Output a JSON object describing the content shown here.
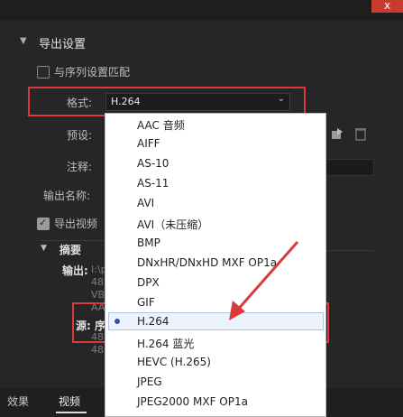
{
  "window": {
    "close_glyph": "x"
  },
  "export_settings": {
    "title": "导出设置",
    "match_sequence_label": "与序列设置匹配",
    "format_label": "格式:",
    "format_value": "H.264",
    "preset_label": "预设:",
    "comment_label": "注释:",
    "output_name_label": "输出名称:",
    "export_video_label": "导出视频",
    "summary_title": "摘要",
    "output_label": "输出:",
    "output_path_partial": "I:\\p",
    "output_lines": [
      "48",
      "VB",
      "AA",
      "48"
    ],
    "source_label": "源: 序",
    "source_lines": [
      "48",
      "48"
    ]
  },
  "format_options": [
    "AAC 音频",
    "AIFF",
    "AS-10",
    "AS-11",
    "AVI",
    "AVI（未压缩）",
    "BMP",
    "DNxHR/DNxHD MXF OP1a",
    "DPX",
    "GIF",
    "H.264",
    "H.264 蓝光",
    "HEVC (H.265)",
    "JPEG",
    "JPEG2000 MXF OP1a"
  ],
  "selected_format": "H.264",
  "tabs": {
    "effects": "效果",
    "video": "视频"
  },
  "colors": {
    "annotation_red": "#d93a3a",
    "selected_dot": "#3c4ea6"
  }
}
